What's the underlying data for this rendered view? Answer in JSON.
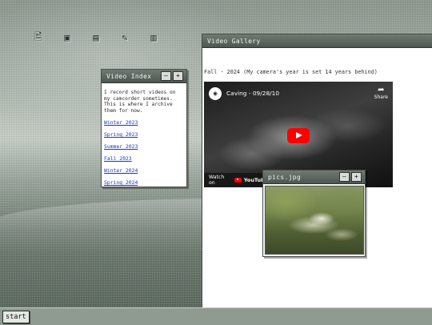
{
  "desktop": {
    "icons": [
      {
        "name": "document-icon",
        "glyph": "🗎"
      },
      {
        "name": "package-icon",
        "glyph": "▣"
      },
      {
        "name": "book-icon",
        "glyph": "▤"
      },
      {
        "name": "paint-icon",
        "glyph": "✎"
      },
      {
        "name": "notes-icon",
        "glyph": "▥"
      }
    ]
  },
  "video_index": {
    "title": "Video Index",
    "intro": "I record short videos on my camcorder sometimes. This is where I archive them for now.",
    "links": [
      {
        "label": "Winter 2023"
      },
      {
        "label": "Spring 2023"
      },
      {
        "label": "Summer 2023"
      },
      {
        "label": "Fall 2023"
      },
      {
        "label": "Winter 2024"
      },
      {
        "label": "Spring 2024"
      }
    ],
    "minimize_label": "–",
    "maximize_label": "+"
  },
  "video_gallery": {
    "title": "Video Gallery",
    "caption": "Fall - 2024 (My camera's year is set 14 years behind)",
    "video": {
      "title": "Caving - 09/28/10",
      "share_label": "Share",
      "watch_on": "Watch on",
      "youtube_wordmark": "YouTube"
    }
  },
  "pics_window": {
    "title": "pics.jpg",
    "minimize_label": "–",
    "maximize_label": "+"
  },
  "taskbar": {
    "start_label": "start"
  }
}
